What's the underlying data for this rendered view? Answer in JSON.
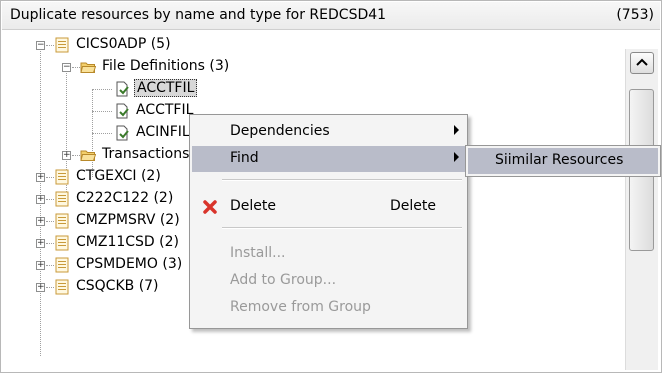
{
  "header": {
    "title": "Duplicate resources by name and type for REDCSD41",
    "count": "(753)"
  },
  "tree": {
    "nodes": [
      {
        "label": "CICS0ADP (5)",
        "expander": "−"
      },
      {
        "label": "File Definitions (3)",
        "expander": "−"
      },
      {
        "label": "ACCTFIL"
      },
      {
        "label": "ACCTFIL"
      },
      {
        "label": "ACINFIL"
      },
      {
        "label": "Transactions",
        "expander": "+"
      },
      {
        "label": "CTGEXCI (2)",
        "expander": "+"
      },
      {
        "label": "C222C122 (2)",
        "expander": "+"
      },
      {
        "label": "CMZPMSRV (2)",
        "expander": "+"
      },
      {
        "label": "CMZ11CSD (2)",
        "expander": "+"
      },
      {
        "label": "CPSMDEMO (3)",
        "expander": "+"
      },
      {
        "label": "CSQCKB (7)",
        "expander": "+"
      }
    ]
  },
  "context_menu": {
    "dependencies": "Dependencies",
    "find": "Find",
    "delete": "Delete",
    "delete_shortcut": "Delete",
    "install": "Install...",
    "add_to_group": "Add to Group...",
    "remove_from_group": "Remove from Group"
  },
  "submenu": {
    "similar_resources": "Siimilar Resources"
  },
  "colors": {
    "highlight": "#b9bcc9",
    "folder": "#e8b84a",
    "delete_x": "#d9342b",
    "doc_icon": "#3a7a2a"
  }
}
